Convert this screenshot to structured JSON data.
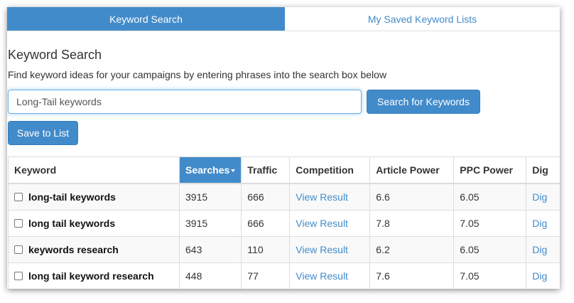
{
  "tabs": [
    {
      "label": "Keyword Search",
      "active": true
    },
    {
      "label": "My Saved Keyword Lists",
      "active": false
    }
  ],
  "page": {
    "title": "Keyword Search",
    "description": "Find keyword ideas for your campaigns by entering phrases into the search box below"
  },
  "search": {
    "value": "Long-Tail keywords",
    "button_label": "Search for Keywords"
  },
  "actions": {
    "save_label": "Save to List"
  },
  "table": {
    "headers": [
      "Keyword",
      "Searches",
      "Traffic",
      "Competition",
      "Article Power",
      "PPC Power",
      "Dig"
    ],
    "sorted_column": "Searches",
    "rows": [
      {
        "keyword": "long-tail keywords",
        "searches": "3915",
        "traffic": "666",
        "competition": "View Result",
        "article_power": "6.6",
        "ppc_power": "6.05",
        "dig": "Dig"
      },
      {
        "keyword": "long tail keywords",
        "searches": "3915",
        "traffic": "666",
        "competition": "View Result",
        "article_power": "7.8",
        "ppc_power": "7.05",
        "dig": "Dig"
      },
      {
        "keyword": "keywords research",
        "searches": "643",
        "traffic": "110",
        "competition": "View Result",
        "article_power": "6.2",
        "ppc_power": "6.05",
        "dig": "Dig"
      },
      {
        "keyword": "long tail keyword research",
        "searches": "448",
        "traffic": "77",
        "competition": "View Result",
        "article_power": "7.6",
        "ppc_power": "7.05",
        "dig": "Dig"
      }
    ]
  },
  "colors": {
    "accent": "#428bca",
    "row_stripe": "#f9f9f9",
    "border": "#dddddd"
  }
}
